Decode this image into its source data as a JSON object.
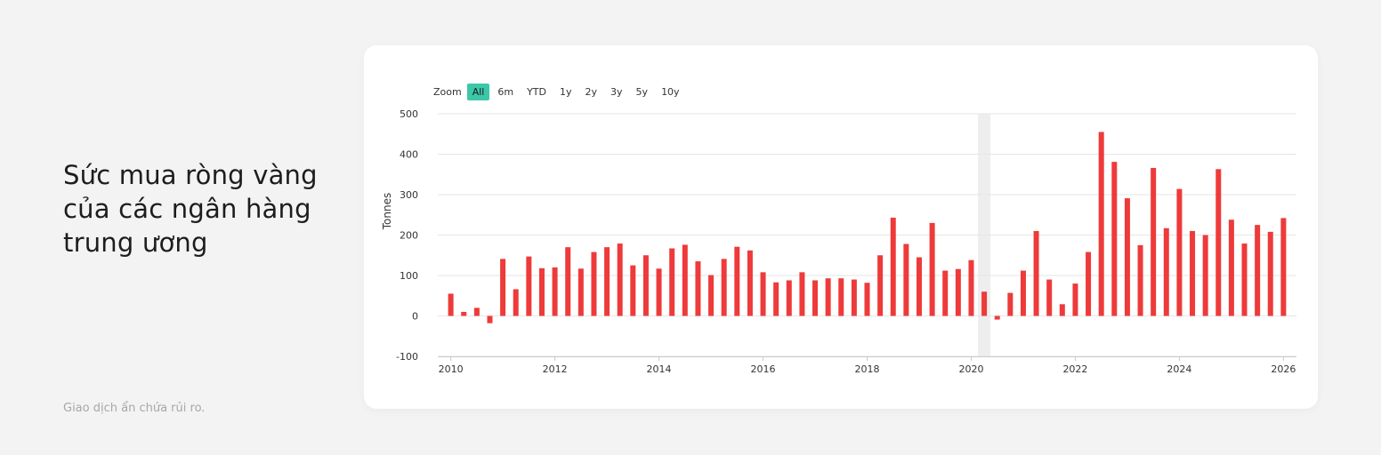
{
  "headline": {
    "lines": [
      "Sức mua ròng vàng",
      "của các ngân hàng",
      "trung ương"
    ]
  },
  "disclaimer": "Giao dịch ẩn chứa rủi ro.",
  "zoom": {
    "label": "Zoom",
    "options": [
      "All",
      "6m",
      "YTD",
      "1y",
      "2y",
      "3y",
      "5y",
      "10y"
    ],
    "selected": "All"
  },
  "colors": {
    "bar": "#ee3a3a",
    "accent": "#3cc8a8",
    "grid": "#e6e6e6",
    "highlight": "#eeeeee"
  },
  "chart_data": {
    "type": "bar",
    "ylabel": "Tonnes",
    "ylim": [
      -100,
      500
    ],
    "yticks": [
      500,
      400,
      300,
      200,
      100,
      0,
      -100
    ],
    "xlim": [
      2009.75,
      2026.25
    ],
    "xticks": [
      2010,
      2012,
      2014,
      2016,
      2018,
      2020,
      2022,
      2024,
      2026
    ],
    "grid": true,
    "highlight_range": [
      2020.13,
      2020.37
    ],
    "x": [
      2010,
      2010.25,
      2010.5,
      2010.75,
      2011,
      2011.25,
      2011.5,
      2011.75,
      2012,
      2012.25,
      2012.5,
      2012.75,
      2013,
      2013.25,
      2013.5,
      2013.75,
      2014,
      2014.25,
      2014.5,
      2014.75,
      2015,
      2015.25,
      2015.5,
      2015.75,
      2016,
      2016.25,
      2016.5,
      2016.75,
      2017,
      2017.25,
      2017.5,
      2017.75,
      2018,
      2018.25,
      2018.5,
      2018.75,
      2019,
      2019.25,
      2019.5,
      2019.75,
      2020,
      2020.25,
      2020.5,
      2020.75,
      2021,
      2021.25,
      2021.5,
      2021.75,
      2022,
      2022.25,
      2022.5,
      2022.75,
      2023,
      2023.25,
      2023.5,
      2023.75,
      2024,
      2024.25,
      2024.5,
      2024.75,
      2025,
      2025.25,
      2025.5,
      2025.75,
      2026
    ],
    "values": [
      55,
      10,
      20,
      -18,
      141,
      66,
      147,
      118,
      120,
      170,
      117,
      158,
      170,
      179,
      125,
      150,
      117,
      167,
      176,
      135,
      101,
      141,
      171,
      162,
      108,
      83,
      88,
      108,
      88,
      93,
      93,
      90,
      82,
      150,
      243,
      178,
      145,
      230,
      112,
      116,
      138,
      60,
      -9,
      57,
      112,
      210,
      90,
      29,
      80,
      158,
      455,
      381,
      291,
      175,
      366,
      217,
      314,
      210,
      200,
      363,
      238,
      179,
      225,
      208,
      242
    ]
  }
}
